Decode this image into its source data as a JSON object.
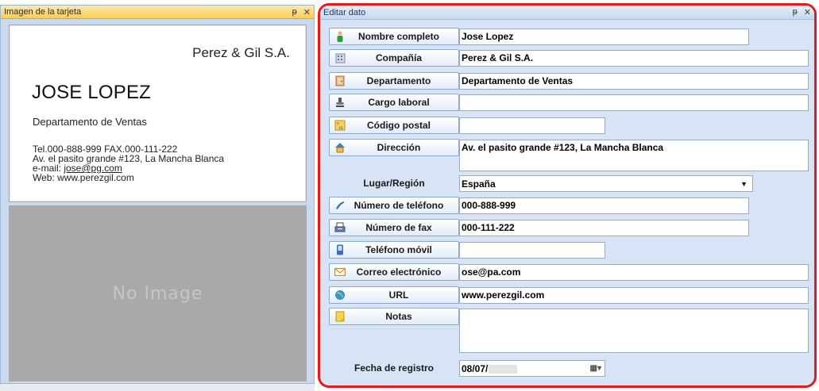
{
  "left_pane": {
    "title": "Imagen de la tarjeta",
    "pin_glyph": "ᵽ",
    "close_glyph": "✕",
    "card": {
      "company": "Perez & Gil S.A.",
      "name": "JOSE LOPEZ",
      "department": "Departamento de Ventas",
      "phone_fax": "Tel.000-888-999   FAX.000-111-222",
      "address": "Av. el pasito grande #123, La Mancha Blanca",
      "email_prefix": "e-mail: ",
      "email": "jose@pg.com",
      "web": "Web: www.perezgil.com"
    },
    "no_image": "No Image"
  },
  "right_pane": {
    "title": "Editar dato",
    "pin_glyph": "ᵽ",
    "close_glyph": "✕",
    "fields": {
      "nombre": {
        "label": "Nombre completo",
        "value": "Jose Lopez",
        "icon": "person-icon"
      },
      "compania": {
        "label": "Compañía",
        "value": "Perez & Gil S.A.",
        "icon": "building-icon"
      },
      "departamento": {
        "label": "Departamento",
        "value": "Departamento de Ventas",
        "icon": "door-icon"
      },
      "cargo": {
        "label": "Cargo laboral",
        "value": "",
        "icon": "stamp-icon"
      },
      "codigo_postal": {
        "label": "Código postal",
        "value": "",
        "icon": "postal-icon"
      },
      "direccion": {
        "label": "Dirección",
        "value": "Av. el pasito grande #123, La Mancha Blanca",
        "icon": "house-icon"
      },
      "lugar": {
        "label": "Lugar/Región",
        "value": "España"
      },
      "telefono": {
        "label": "Número de teléfono",
        "value": "000-888-999",
        "icon": "phone-icon"
      },
      "fax": {
        "label": "Número de fax",
        "value": "000-111-222",
        "icon": "fax-icon"
      },
      "movil": {
        "label": "Teléfono móvil",
        "value": "",
        "icon": "mobile-icon"
      },
      "correo": {
        "label": "Correo electrónico",
        "value": "ose@pa.com",
        "icon": "envelope-icon"
      },
      "url": {
        "label": "URL",
        "value": "www.perezgil.com",
        "icon": "globe-icon"
      },
      "notas": {
        "label": "Notas",
        "value": "",
        "icon": "note-icon"
      },
      "fecha": {
        "label": "Fecha de registro",
        "value": "08/07/"
      }
    }
  },
  "colors": {
    "highlight_border": "#e21d1d",
    "pane_background": "#d6e4f6"
  }
}
